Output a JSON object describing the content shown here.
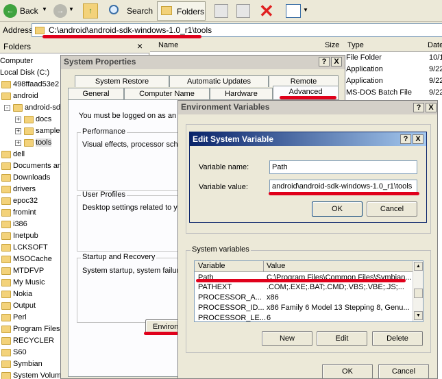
{
  "toolbar": {
    "back_label": "Back",
    "search_label": "Search",
    "folders_label": "Folders"
  },
  "address": {
    "label": "Address",
    "value": "C:\\android\\android-sdk-windows-1.0_r1\\tools"
  },
  "folders_pane": {
    "title": "Folders",
    "close": "×",
    "items": [
      "Computer",
      "Local Disk (C:)",
      "498ffaad53e2",
      "android",
      "android-sdk",
      "docs",
      "samples",
      "tools",
      "dell",
      "Documents and",
      "Downloads",
      "drivers",
      "epoc32",
      "fromint",
      "i386",
      "Inetpub",
      "LCKSOFT",
      "MSOCache",
      "MTDFVP",
      "My Music",
      "Nokia",
      "Output",
      "Perl",
      "Program Files",
      "RECYCLER",
      "S60",
      "Symbian",
      "System Volum"
    ]
  },
  "file_list": {
    "columns": [
      "Name",
      "Size",
      "Type",
      "Date"
    ],
    "rows": [
      {
        "type": "File Folder",
        "date": "10/1"
      },
      {
        "type": "Application",
        "date": "9/22"
      },
      {
        "type": "Application",
        "date": "9/22"
      },
      {
        "type": "MS-DOS Batch File",
        "date": "9/22"
      }
    ]
  },
  "system_properties": {
    "title": "System Properties",
    "tabs_row1": [
      "System Restore",
      "Automatic Updates",
      "Remote"
    ],
    "tabs_row2": [
      "General",
      "Computer Name",
      "Hardware",
      "Advanced"
    ],
    "logon_text": "You must be logged on as an A",
    "performance_label": "Performance",
    "performance_text": "Visual effects, processor sche",
    "user_profiles_label": "User Profiles",
    "user_profiles_text": "Desktop settings related to yo",
    "startup_label": "Startup and Recovery",
    "startup_text": "System startup, system failure",
    "env_button": "Environ"
  },
  "env_vars": {
    "title": "Environment Variables",
    "system_variables_label": "System variables",
    "col_variable": "Variable",
    "col_value": "Value",
    "rows": [
      {
        "variable": "Path",
        "value": "C:\\Program Files\\Common Files\\Symbian..."
      },
      {
        "variable": "PATHEXT",
        "value": ".COM;.EXE;.BAT;.CMD;.VBS;.VBE;.JS;..."
      },
      {
        "variable": "PROCESSOR_A...",
        "value": "x86"
      },
      {
        "variable": "PROCESSOR_ID...",
        "value": "x86 Family 6 Model 13 Stepping 8, Genu..."
      },
      {
        "variable": "PROCESSOR_LE...",
        "value": "6"
      }
    ],
    "new_button": "New",
    "edit_button": "Edit",
    "delete_button": "Delete",
    "ok_button": "OK",
    "cancel_button": "Cancel"
  },
  "edit_var": {
    "title": "Edit System Variable",
    "name_label": "Variable name:",
    "name_value": "Path",
    "value_label": "Variable value:",
    "value_value": "android\\android-sdk-windows-1.0_r1\\tools",
    "ok_button": "OK",
    "cancel_button": "Cancel"
  },
  "window_buttons": {
    "help": "?",
    "close": "X"
  },
  "colors": {
    "annotation_red": "#e0001b",
    "xp_blue": "#0a246a"
  }
}
